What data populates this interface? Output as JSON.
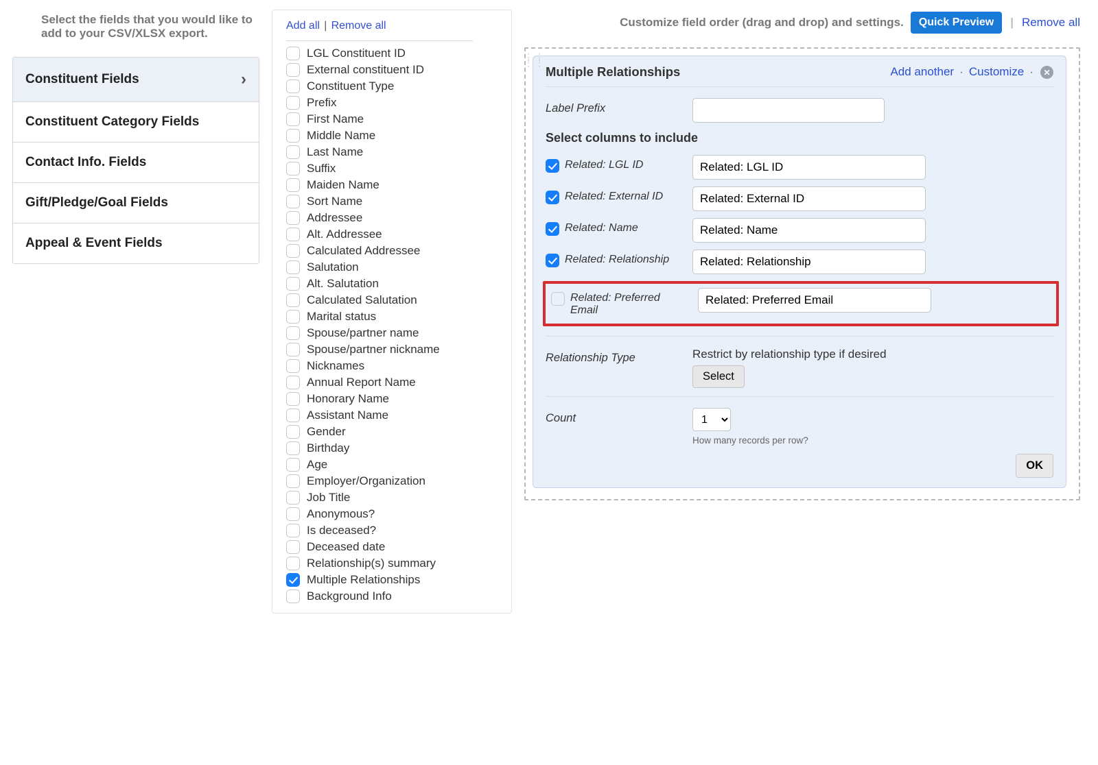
{
  "header": {
    "left_text": "Select the fields that you would like to add to your CSV/XLSX export.",
    "right_text": "Customize field order (drag and drop) and settings.",
    "quick_preview": "Quick Preview",
    "remove_all": "Remove all"
  },
  "categories": [
    {
      "label": "Constituent Fields",
      "active": true
    },
    {
      "label": "Constituent Category Fields",
      "active": false
    },
    {
      "label": "Contact Info. Fields",
      "active": false
    },
    {
      "label": "Gift/Pledge/Goal Fields",
      "active": false
    },
    {
      "label": "Appeal & Event Fields",
      "active": false
    }
  ],
  "field_actions": {
    "add_all": "Add all",
    "remove_all": "Remove all"
  },
  "fields": [
    {
      "label": "LGL Constituent ID",
      "checked": false
    },
    {
      "label": "External constituent ID",
      "checked": false
    },
    {
      "label": "Constituent Type",
      "checked": false
    },
    {
      "label": "Prefix",
      "checked": false
    },
    {
      "label": "First Name",
      "checked": false
    },
    {
      "label": "Middle Name",
      "checked": false
    },
    {
      "label": "Last Name",
      "checked": false
    },
    {
      "label": "Suffix",
      "checked": false
    },
    {
      "label": "Maiden Name",
      "checked": false
    },
    {
      "label": "Sort Name",
      "checked": false
    },
    {
      "label": "Addressee",
      "checked": false
    },
    {
      "label": "Alt. Addressee",
      "checked": false
    },
    {
      "label": "Calculated Addressee",
      "checked": false
    },
    {
      "label": "Salutation",
      "checked": false
    },
    {
      "label": "Alt. Salutation",
      "checked": false
    },
    {
      "label": "Calculated Salutation",
      "checked": false
    },
    {
      "label": "Marital status",
      "checked": false
    },
    {
      "label": "Spouse/partner name",
      "checked": false
    },
    {
      "label": "Spouse/partner nickname",
      "checked": false
    },
    {
      "label": "Nicknames",
      "checked": false
    },
    {
      "label": "Annual Report Name",
      "checked": false
    },
    {
      "label": "Honorary Name",
      "checked": false
    },
    {
      "label": "Assistant Name",
      "checked": false
    },
    {
      "label": "Gender",
      "checked": false
    },
    {
      "label": "Birthday",
      "checked": false
    },
    {
      "label": "Age",
      "checked": false
    },
    {
      "label": "Employer/Organization",
      "checked": false
    },
    {
      "label": "Job Title",
      "checked": false
    },
    {
      "label": "Anonymous?",
      "checked": false
    },
    {
      "label": "Is deceased?",
      "checked": false
    },
    {
      "label": "Deceased date",
      "checked": false
    },
    {
      "label": "Relationship(s) summary",
      "checked": false
    },
    {
      "label": "Multiple Relationships",
      "checked": true
    },
    {
      "label": "Background Info",
      "checked": false
    }
  ],
  "panel": {
    "title": "Multiple Relationships",
    "add_another": "Add another",
    "customize": "Customize",
    "label_prefix_label": "Label Prefix",
    "label_prefix_value": "",
    "select_columns_title": "Select columns to include",
    "columns": [
      {
        "label": "Related: LGL ID",
        "value": "Related: LGL ID",
        "checked": true,
        "highlight": false
      },
      {
        "label": "Related: External ID",
        "value": "Related: External ID",
        "checked": true,
        "highlight": false
      },
      {
        "label": "Related: Name",
        "value": "Related: Name",
        "checked": true,
        "highlight": false
      },
      {
        "label": "Related: Relationship",
        "value": "Related: Relationship",
        "checked": true,
        "highlight": false
      },
      {
        "label": "Related: Preferred Email",
        "value": "Related: Preferred Email",
        "checked": false,
        "highlight": true
      }
    ],
    "relationship_type_label": "Relationship Type",
    "relationship_type_desc": "Restrict by relationship type if desired",
    "select_btn": "Select",
    "count_label": "Count",
    "count_value": "1",
    "count_hint": "How many records per row?",
    "ok": "OK"
  }
}
